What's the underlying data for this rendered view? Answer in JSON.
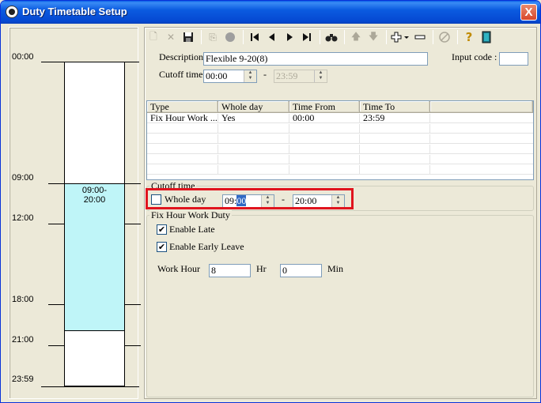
{
  "window": {
    "title": "Duty Timetable Setup",
    "close_label": "X"
  },
  "timeline": {
    "labels": [
      "00:00",
      "09:00",
      "12:00",
      "18:00",
      "21:00",
      "23:59"
    ],
    "block_label_line1": "09:00-",
    "block_label_line2": "20:00",
    "block_color": "#bff5f8"
  },
  "toolbar": {
    "icons": [
      "new-icon",
      "delete-icon",
      "save-icon",
      "copy-icon",
      "record-icon",
      "first-icon",
      "prev-icon",
      "next-icon",
      "last-icon",
      "find-icon",
      "up-icon",
      "down-icon",
      "add-icon",
      "remove-icon",
      "disabled-icon",
      "help-icon",
      "exit-icon"
    ]
  },
  "form": {
    "description_label": "Description",
    "description_value": "Flexible 9-20(8)",
    "input_code_label": "Input code :",
    "input_code_value": "",
    "cutoff_label": "Cutoff time",
    "cutoff_from": "00:00",
    "cutoff_dash": "-",
    "cutoff_to": "23:59"
  },
  "grid": {
    "headers": [
      "Type",
      "Whole day",
      "Time From",
      "Time To"
    ],
    "rows": [
      [
        "Fix Hour Work ...",
        "Yes",
        "00:00",
        "23:59"
      ]
    ]
  },
  "cutoff_group": {
    "title": "Cutoff time",
    "whole_day_label": "Whole day",
    "from_hour": "09:",
    "from_min": "00",
    "dash": "-",
    "to_value": "20:00"
  },
  "fix_hour_group": {
    "title": "Fix Hour Work Duty",
    "enable_late_label": "Enable Late",
    "enable_late_checked": "✔",
    "enable_early_label": "Enable Early Leave",
    "enable_early_checked": "✔",
    "work_hour_label": "Work Hour",
    "hr_value": "8",
    "hr_label": "Hr",
    "min_value": "0",
    "min_label": "Min"
  },
  "colors": {
    "highlight_border": "#e0141e",
    "title_bar": "#0548d1"
  }
}
